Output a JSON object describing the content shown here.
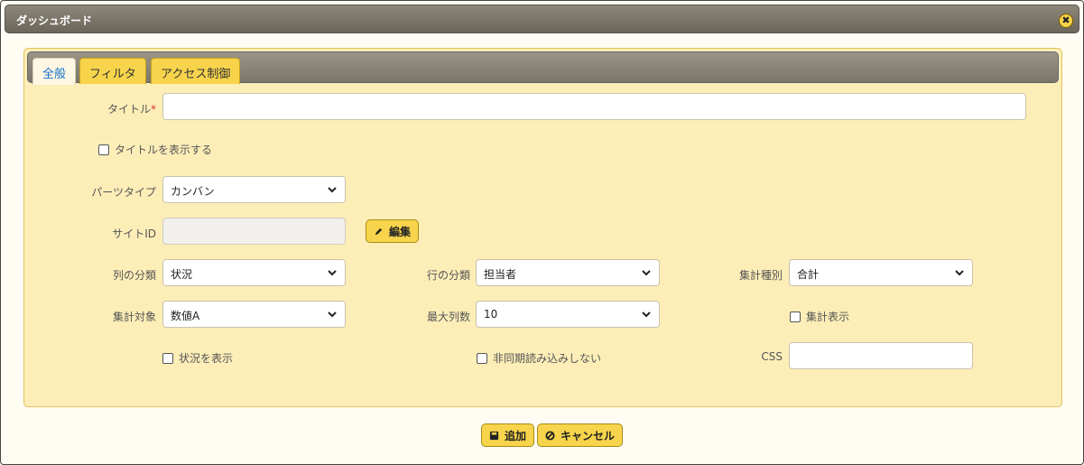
{
  "window": {
    "title": "ダッシュボード"
  },
  "tabs": [
    {
      "label": "全般"
    },
    {
      "label": "フィルタ"
    },
    {
      "label": "アクセス制御"
    }
  ],
  "form": {
    "title_label": "タイトル",
    "title_required": "*",
    "title_value": "",
    "show_title_label": "タイトルを表示する",
    "parts_type_label": "パーツタイプ",
    "parts_type_value": "カンバン",
    "site_id_label": "サイトID",
    "site_id_value": "",
    "edit_label": "編集",
    "column_group_label": "列の分類",
    "column_group_value": "状況",
    "row_group_label": "行の分類",
    "row_group_value": "担当者",
    "agg_type_label": "集計種別",
    "agg_type_value": "合計",
    "agg_target_label": "集計対象",
    "agg_target_value": "数値A",
    "max_columns_label": "最大列数",
    "max_columns_value": "10",
    "show_agg_label": "集計表示",
    "show_status_label": "状況を表示",
    "no_async_label": "非同期読み込みしない",
    "css_label": "CSS",
    "css_value": ""
  },
  "buttons": {
    "add_label": "追加",
    "cancel_label": "キャンセル"
  },
  "colors": {
    "accent": "#f7d44b",
    "panel_bg": "#fdeeb8",
    "active_tab_text": "#1a73c9",
    "required": "#dd3333"
  }
}
